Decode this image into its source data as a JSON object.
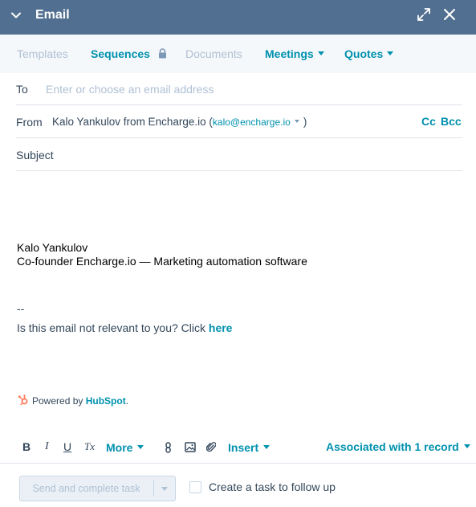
{
  "header": {
    "title": "Email"
  },
  "tabs": [
    {
      "label": "Templates",
      "state": "disabled"
    },
    {
      "label": "Sequences",
      "state": "active",
      "icon": "lock-icon"
    },
    {
      "label": "Documents",
      "state": "disabled"
    },
    {
      "label": "Meetings",
      "state": "active",
      "dropdown": true
    },
    {
      "label": "Quotes",
      "state": "active",
      "dropdown": true
    }
  ],
  "to": {
    "label": "To",
    "placeholder": "Enter or choose an email address",
    "value": ""
  },
  "from": {
    "label": "From",
    "sender_name": "Kalo Yankulov from Encharge.io",
    "open_paren": "(",
    "sender_email": "kalo@encharge.io",
    "close_paren": ")",
    "cc": "Cc",
    "bcc": "Bcc"
  },
  "subject": {
    "label": "Subject",
    "value": ""
  },
  "body": {
    "signature_name": "Kalo Yankulov",
    "signature_title": "Co-founder Encharge.io — Marketing automation software",
    "separator": "--",
    "unsubscribe_text": "Is this email not relevant to you? Click ",
    "unsubscribe_link": "here"
  },
  "powered_by": {
    "prefix": "Powered by ",
    "brand": "HubSpot",
    "suffix": "."
  },
  "toolbar": {
    "bold": "B",
    "italic": "I",
    "underline": "U",
    "clear_format": "Tx",
    "more": "More",
    "insert": "Insert",
    "associated": "Associated with 1 record"
  },
  "footer": {
    "send_label": "Send and complete task",
    "followup_label": "Create a task to follow up",
    "followup_checked": false
  },
  "colors": {
    "header_bg": "#516f90",
    "accent": "#0091ae",
    "disabled_text": "#b0c1d4",
    "text": "#33475b",
    "hubspot_orange": "#ff7a59"
  }
}
